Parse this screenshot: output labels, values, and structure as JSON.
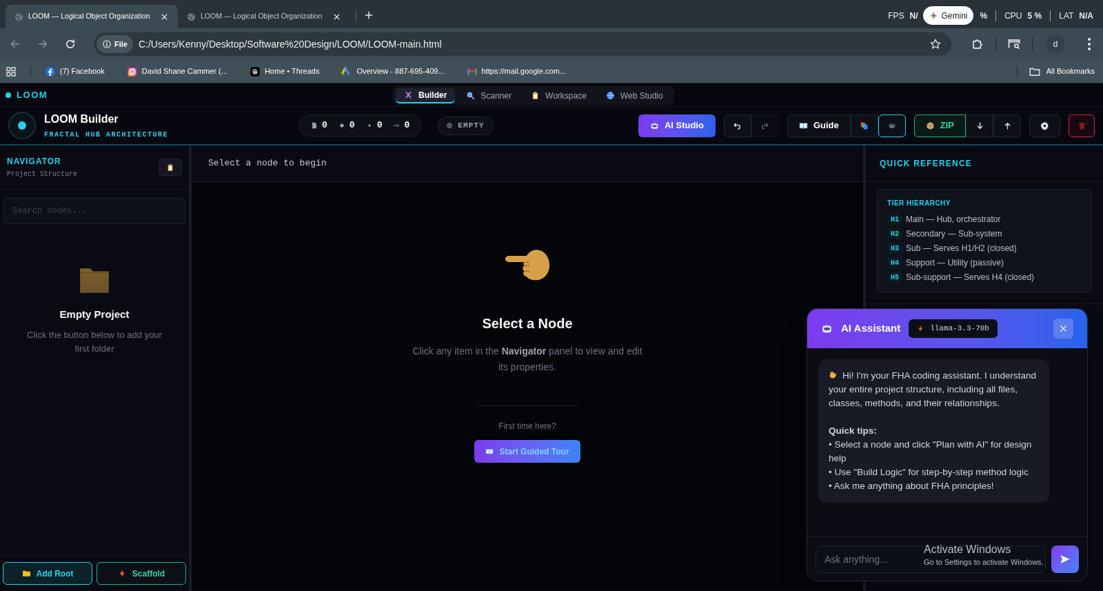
{
  "browser": {
    "tabs": [
      {
        "title": "LOOM — Logical Object Organization",
        "selected": true
      },
      {
        "title": "LOOM — Logical Object Organization",
        "selected": false
      }
    ],
    "perf": [
      {
        "kind": "metric",
        "label": "FPS",
        "value": "N/"
      },
      {
        "kind": "chip",
        "label": "Gemini"
      },
      {
        "kind": "value",
        "value": "%"
      },
      {
        "kind": "metric",
        "label": "CPU",
        "value": "5 %"
      },
      {
        "kind": "metric",
        "label": "LAT",
        "value": "N/A"
      }
    ],
    "address": {
      "badge": "File",
      "url": "C:/Users/Kenny/Desktop/Software%20Design/LOOM/LOOM-main.html"
    },
    "profile": "d",
    "bookmarks": [
      {
        "kind": "facebook",
        "label": "(7) Facebook"
      },
      {
        "kind": "instagram",
        "label": "David Shane Cammer (..."
      },
      {
        "kind": "threads",
        "label": "Home • Threads"
      },
      {
        "kind": "ads",
        "label": "Overview - 887-695-409..."
      },
      {
        "kind": "gmail",
        "label": "https://mail.google.com..."
      }
    ],
    "all_bookmarks": "All Bookmarks"
  },
  "app": {
    "brand": "LOOM",
    "nav": [
      {
        "kind": "dna",
        "label": "Builder",
        "selected": true
      },
      {
        "kind": "search",
        "label": "Scanner",
        "selected": false
      },
      {
        "kind": "clipboard",
        "label": "Workspace",
        "selected": false
      },
      {
        "kind": "globe",
        "label": "Web Studio",
        "selected": false
      }
    ],
    "header": {
      "title": "LOOM Builder",
      "subtitle": "FRACTAL HUB ARCHITECTURE"
    },
    "stats": [
      {
        "kind": "file",
        "value": "0"
      },
      {
        "kind": "diamond",
        "value": "0"
      },
      {
        "kind": "dot",
        "value": "0"
      },
      {
        "kind": "arrow",
        "value": "0"
      }
    ],
    "status": "EMPTY",
    "toolbar": [
      [
        {
          "kind": "ai",
          "label": "AI Studio"
        }
      ],
      [
        {
          "kind": "undo",
          "disabled": false
        },
        {
          "kind": "redo",
          "disabled": true
        }
      ],
      [
        {
          "kind": "guide",
          "label": "Guide",
          "active": false
        },
        {
          "kind": "layers",
          "active": false
        },
        {
          "kind": "cap",
          "active": true
        }
      ],
      [
        {
          "kind": "zip",
          "label": "ZIP"
        },
        {
          "kind": "down"
        },
        {
          "kind": "up"
        }
      ],
      [
        {
          "kind": "gear"
        }
      ],
      [
        {
          "kind": "trash"
        }
      ]
    ],
    "navigator": {
      "title": "NAVIGATOR",
      "subtitle": "Project Structure",
      "search_placeholder": "Search nodes...",
      "empty_title": "Empty Project",
      "empty_text": "Click the button below to add your first folder",
      "buttons": [
        {
          "kind": "folder",
          "label": "Add Root"
        },
        {
          "kind": "bolt",
          "label": "Scaffold"
        }
      ]
    },
    "editor": {
      "header": "Select a node to begin",
      "title": "Select a Node",
      "description": "Click any item in the **Navigator** panel to view and edit its properties.",
      "prompt": "First time here?",
      "tour_button": "Start Guided Tour"
    },
    "reference": {
      "title": "QUICK REFERENCE",
      "card_title": "TIER HIERARCHY",
      "tiers": [
        {
          "code": "H1",
          "label": "Main — Hub, orchestrator"
        },
        {
          "code": "H2",
          "label": "Secondary — Sub-system"
        },
        {
          "code": "H3",
          "label": "Sub — Serves H1/H2 (closed)"
        },
        {
          "code": "H4",
          "label": "Support — Utility (passive)"
        },
        {
          "code": "H5",
          "label": "Sub-support — Serves H4 (closed)"
        }
      ]
    },
    "assistant": {
      "title": "AI Assistant",
      "model": "llama-3.3-70b",
      "intro": "Hi! I'm your FHA coding assistant. I understand your entire project structure, including all files, classes, methods, and their relationships.",
      "tips_title": "Quick tips:",
      "tips": [
        "• Select a node and click \"Plan with AI\" for design help",
        "• Use \"Build Logic\" for step-by-step method logic",
        "• Ask me anything about FHA principles!"
      ],
      "input_placeholder": "Ask anything..."
    }
  },
  "os_notice": {
    "title": "Activate Windows",
    "text": "Go to Settings to activate Windows."
  }
}
